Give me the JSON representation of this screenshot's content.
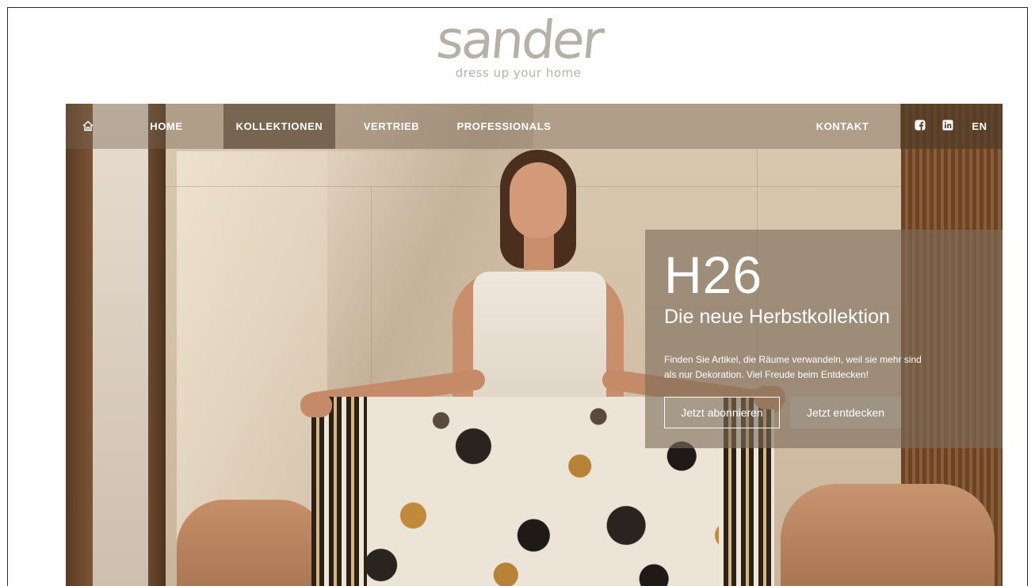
{
  "logo": {
    "wordmark": "sander",
    "tagline": "dress up your home"
  },
  "nav": {
    "home_icon": "home-icon",
    "items": [
      {
        "label": "HOME",
        "active": false
      },
      {
        "label": "KOLLEKTIONEN",
        "active": true
      },
      {
        "label": "VERTRIEB",
        "active": false
      },
      {
        "label": "PROFESSIONALS",
        "active": false
      }
    ],
    "contact": "KONTAKT",
    "social": [
      "facebook-icon",
      "linkedin-icon"
    ],
    "language": "EN"
  },
  "hero": {
    "title": "H26",
    "subtitle": "Die neue Herbstkollektion",
    "text": "Finden Sie Artikel, die Räume verwandeln, weil sie mehr sind als nur Dekoration. Viel Freude beim Entdecken!",
    "button_subscribe": "Jetzt abonnieren",
    "button_discover": "Jetzt entdecken"
  },
  "colors": {
    "logo": "#b7b0a6",
    "nav_active": "#6e5c48",
    "card_bg": "#7d6c5a"
  }
}
